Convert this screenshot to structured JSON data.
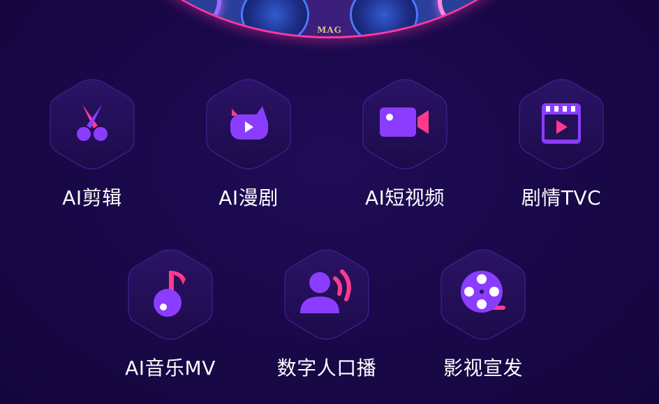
{
  "banner": {
    "logo_text": "MAG"
  },
  "colors": {
    "background": "#190848",
    "tile_fill": "#241057",
    "tile_border": "#3b1e86",
    "icon_purple": "#8b3dff",
    "icon_pink": "#ff3a8c",
    "label": "#ffffff"
  },
  "features": [
    {
      "label": "AI剪辑",
      "icon": "scissors-icon"
    },
    {
      "label": "AI漫剧",
      "icon": "comic-cat-icon"
    },
    {
      "label": "AI短视频",
      "icon": "video-camera-icon"
    },
    {
      "label": "剧情TVC",
      "icon": "clapperboard-icon"
    },
    {
      "label": "AI音乐MV",
      "icon": "music-note-icon"
    },
    {
      "label": "数字人口播",
      "icon": "digital-human-icon"
    },
    {
      "label": "影视宣发",
      "icon": "film-reel-icon"
    }
  ]
}
